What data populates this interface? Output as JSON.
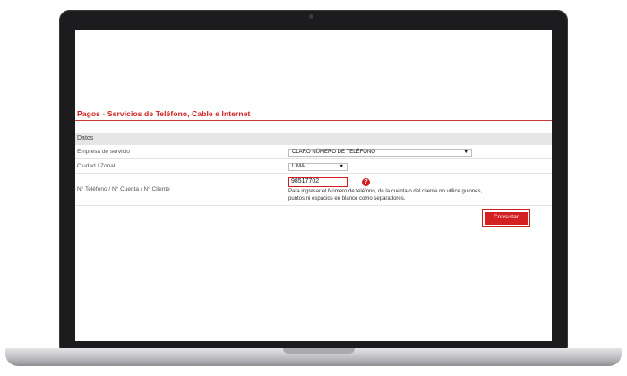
{
  "page": {
    "title": "Pagos - Servicios de Teléfono, Cable e Internet",
    "section": "Datos"
  },
  "form": {
    "empresa": {
      "label": "Empresa de servicio",
      "selected": "CLARO NÚMERO DE TELÉFONO"
    },
    "ciudad": {
      "label": "Ciudad / Zonal",
      "selected": "LIMA"
    },
    "numero": {
      "label": "N° Teléfono / N° Cuenta / N° Cliente",
      "value": "98517702",
      "hint": "Para ingresar el Número de teléfono, de la cuenta o del cliente no utilice guiones, puntos,ni espacios en blanco como separadores."
    },
    "help_glyph": "?",
    "dropdown_glyph": "▼",
    "submit_label": "Consultar"
  },
  "colors": {
    "accent": "#d11d1d",
    "section_bg": "#e6e6e6"
  }
}
